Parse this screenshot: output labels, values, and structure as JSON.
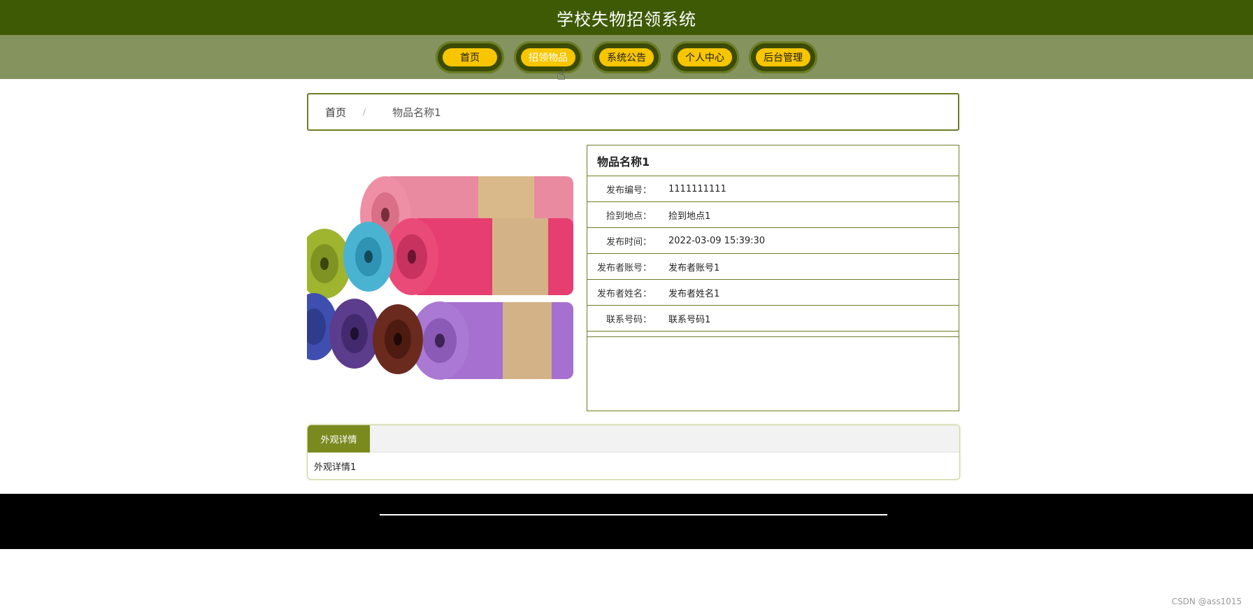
{
  "header": {
    "title": "学校失物招领系统"
  },
  "nav": {
    "items": [
      {
        "label": "首页"
      },
      {
        "label": "招领物品"
      },
      {
        "label": "系统公告"
      },
      {
        "label": "个人中心"
      },
      {
        "label": "后台管理"
      }
    ]
  },
  "breadcrumb": {
    "home": "首页",
    "separator": "/",
    "current": "物品名称1"
  },
  "item": {
    "name": "物品名称1",
    "fields": [
      {
        "label": "发布编号：",
        "value": "1111111111"
      },
      {
        "label": "捡到地点：",
        "value": "捡到地点1"
      },
      {
        "label": "发布时间：",
        "value": "2022-03-09 15:39:30"
      },
      {
        "label": "发布者账号：",
        "value": "发布者账号1"
      },
      {
        "label": "发布者姓名：",
        "value": "发布者姓名1"
      },
      {
        "label": "联系号码：",
        "value": "联系号码1"
      }
    ]
  },
  "details": {
    "tab_label": "外观详情",
    "content": "外观详情1"
  },
  "watermark": "CSDN @ass1015",
  "colors": {
    "header": "#3e5a05",
    "nav": "#85935e",
    "pill": "#f7c600",
    "border": "#6b7e25",
    "footer": "#000000"
  }
}
